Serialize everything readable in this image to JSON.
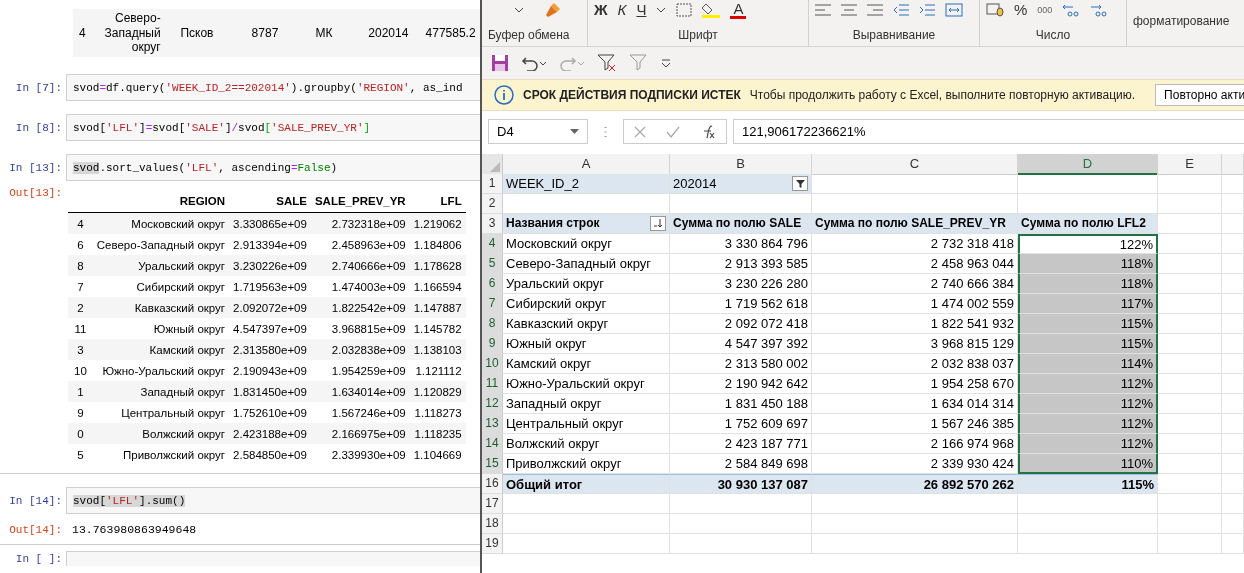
{
  "notebook": {
    "partial_row": [
      "4",
      "Северо-Западный округ",
      "Псков",
      "8787",
      "МК",
      "202014",
      "477585.2"
    ],
    "cells": [
      {
        "kind": "code",
        "prompt": "In [7]:",
        "tokens": [
          {
            "text": "svod",
            "kind": "name",
            "highlight": false
          },
          {
            "text": "=",
            "kind": "op",
            "highlight": false
          },
          {
            "text": "df.query(",
            "kind": "name",
            "highlight": false
          },
          {
            "text": "'WEEK_ID_2==202014'",
            "kind": "string",
            "highlight": false
          },
          {
            "text": ").groupby(",
            "kind": "name",
            "highlight": false
          },
          {
            "text": "'REGION'",
            "kind": "string",
            "highlight": false
          },
          {
            "text": ", as_ind",
            "kind": "name",
            "highlight": false
          }
        ]
      },
      {
        "kind": "code",
        "prompt": "In [8]:",
        "tokens": [
          {
            "text": "svod[",
            "kind": "name",
            "highlight": false
          },
          {
            "text": "'LFL'",
            "kind": "string",
            "highlight": false
          },
          {
            "text": "]",
            "kind": "name",
            "highlight": false
          },
          {
            "text": "=",
            "kind": "op",
            "highlight": false
          },
          {
            "text": "svod[",
            "kind": "name",
            "highlight": false
          },
          {
            "text": "'SALE'",
            "kind": "string",
            "highlight": false
          },
          {
            "text": "]",
            "kind": "name",
            "highlight": false
          },
          {
            "text": "/",
            "kind": "op",
            "highlight": false
          },
          {
            "text": "svod",
            "kind": "name",
            "highlight": false
          },
          {
            "text": "[",
            "kind": "bracket",
            "highlight": false
          },
          {
            "text": "'SALE_PREV_YR'",
            "kind": "string",
            "highlight": false
          },
          {
            "text": "]",
            "kind": "bracket",
            "highlight": false
          }
        ]
      },
      {
        "kind": "code",
        "prompt": "In [13]:",
        "tokens": [
          {
            "text": "svod",
            "kind": "name",
            "highlight": true
          },
          {
            "text": ".sort_values(",
            "kind": "name",
            "highlight": false
          },
          {
            "text": "'LFL'",
            "kind": "string",
            "highlight": false
          },
          {
            "text": ", ascending",
            "kind": "name",
            "highlight": false
          },
          {
            "text": "=",
            "kind": "op",
            "highlight": false
          },
          {
            "text": "False",
            "kind": "keyword",
            "highlight": false
          },
          {
            "text": ")",
            "kind": "name",
            "highlight": false
          }
        ]
      },
      {
        "kind": "table",
        "prompt": "Out[13]:",
        "columns": [
          "",
          "REGION",
          "SALE",
          "SALE_PREV_YR",
          "LFL"
        ],
        "rows": [
          [
            "4",
            "Московский округ",
            "3.330865e+09",
            "2.732318e+09",
            "1.219062"
          ],
          [
            "6",
            "Северо-Западный округ",
            "2.913394e+09",
            "2.458963e+09",
            "1.184806"
          ],
          [
            "8",
            "Уральский округ",
            "3.230226e+09",
            "2.740666e+09",
            "1.178628"
          ],
          [
            "7",
            "Сибирский округ",
            "1.719563e+09",
            "1.474003e+09",
            "1.166594"
          ],
          [
            "2",
            "Кавказский округ",
            "2.092072e+09",
            "1.822542e+09",
            "1.147887"
          ],
          [
            "11",
            "Южный округ",
            "4.547397e+09",
            "3.968815e+09",
            "1.145782"
          ],
          [
            "3",
            "Камский округ",
            "2.313580e+09",
            "2.032838e+09",
            "1.138103"
          ],
          [
            "10",
            "Южно-Уральский округ",
            "2.190943e+09",
            "1.954259e+09",
            "1.121112"
          ],
          [
            "1",
            "Западный округ",
            "1.831450e+09",
            "1.634014e+09",
            "1.120829"
          ],
          [
            "9",
            "Центральный округ",
            "1.752610e+09",
            "1.567246e+09",
            "1.118273"
          ],
          [
            "0",
            "Волжский округ",
            "2.423188e+09",
            "2.166975e+09",
            "1.118235"
          ],
          [
            "5",
            "Приволжский округ",
            "2.584850e+09",
            "2.339930e+09",
            "1.104669"
          ]
        ]
      },
      {
        "kind": "code",
        "prompt": "In [14]:",
        "tokens": [
          {
            "text": "svod[",
            "kind": "name",
            "highlight": true
          },
          {
            "text": "'LFL'",
            "kind": "string",
            "highlight": true
          },
          {
            "text": "].sum()",
            "kind": "name",
            "highlight": true
          }
        ]
      },
      {
        "kind": "text",
        "prompt": "Out[14]:",
        "text": "13.763980863949648"
      },
      {
        "kind": "code",
        "prompt": "In [ ]:"
      }
    ]
  },
  "excel": {
    "ribbon": {
      "font_buttons": [
        "Ж",
        "К",
        "Ч"
      ],
      "font_color": "А",
      "number_buttons": [
        "%",
        "000"
      ],
      "groups": [
        "Буфер обмена",
        "Шрифт",
        "Выравнивание",
        "Число"
      ],
      "partial_label": "форматирование"
    },
    "message_bar": {
      "title": "СРОК ДЕЙСТВИЯ ПОДПИСКИ ИСТЕК",
      "text": "Чтобы продолжить работу с Excel, выполните повторную активацию.",
      "button": "Повторно акти"
    },
    "formula_bar": {
      "name_box": "D4",
      "formula": "121,906172236621%"
    },
    "sheet": {
      "columns": [
        {
          "label": "A",
          "selected": false
        },
        {
          "label": "B",
          "selected": false
        },
        {
          "label": "C",
          "selected": false
        },
        {
          "label": "D",
          "selected": true
        },
        {
          "label": "E",
          "selected": false
        }
      ],
      "rows": [
        {
          "number": "1",
          "kind": "filter",
          "cells": [
            "WEEK_ID_2",
            "202014"
          ]
        },
        {
          "number": "2",
          "kind": "blank"
        },
        {
          "number": "3",
          "kind": "header",
          "cells": [
            "Названия строк",
            "Сумма по полю SALE",
            "Сумма по полю SALE_PREV_YR",
            "Сумма по полю LFL2"
          ]
        },
        {
          "number": "4",
          "kind": "data",
          "selected": true,
          "active": true,
          "cells": [
            "Московский округ",
            "3 330 864 796",
            "2 732 318 418",
            "122%"
          ]
        },
        {
          "number": "5",
          "kind": "data",
          "selected": true,
          "active": false,
          "cells": [
            "Северо-Западный округ",
            "2 913 393 585",
            "2 458 963 044",
            "118%"
          ]
        },
        {
          "number": "6",
          "kind": "data",
          "selected": true,
          "active": false,
          "cells": [
            "Уральский округ",
            "3 230 226 280",
            "2 740 666 384",
            "118%"
          ]
        },
        {
          "number": "7",
          "kind": "data",
          "selected": true,
          "active": false,
          "cells": [
            "Сибирский округ",
            "1 719 562 618",
            "1 474 002 559",
            "117%"
          ]
        },
        {
          "number": "8",
          "kind": "data",
          "selected": true,
          "active": false,
          "cells": [
            "Кавказский округ",
            "2 092 072 418",
            "1 822 541 932",
            "115%"
          ]
        },
        {
          "number": "9",
          "kind": "data",
          "selected": true,
          "active": false,
          "cells": [
            "Южный округ",
            "4 547 397 392",
            "3 968 815 129",
            "115%"
          ]
        },
        {
          "number": "10",
          "kind": "data",
          "selected": true,
          "active": false,
          "cells": [
            "Камский округ",
            "2 313 580 002",
            "2 032 838 037",
            "114%"
          ]
        },
        {
          "number": "11",
          "kind": "data",
          "selected": true,
          "active": false,
          "cells": [
            "Южно-Уральский округ",
            "2 190 942 642",
            "1 954 258 670",
            "112%"
          ]
        },
        {
          "number": "12",
          "kind": "data",
          "selected": true,
          "active": false,
          "cells": [
            "Западный округ",
            "1 831 450 188",
            "1 634 014 314",
            "112%"
          ]
        },
        {
          "number": "13",
          "kind": "data",
          "selected": true,
          "active": false,
          "cells": [
            "Центральный округ",
            "1 752 609 697",
            "1 567 246 385",
            "112%"
          ]
        },
        {
          "number": "14",
          "kind": "data",
          "selected": true,
          "active": false,
          "cells": [
            "Волжский округ",
            "2 423 187 771",
            "2 166 974 968",
            "112%"
          ]
        },
        {
          "number": "15",
          "kind": "data",
          "selected": true,
          "active": false,
          "cells": [
            "Приволжский округ",
            "2 584 849 698",
            "2 339 930 424",
            "110%"
          ]
        },
        {
          "number": "16",
          "kind": "total",
          "cells": [
            "Общий итог",
            "30 930 137 087",
            "26 892 570 262",
            "115%"
          ]
        },
        {
          "number": "17",
          "kind": "blank"
        },
        {
          "number": "18",
          "kind": "blank"
        },
        {
          "number": "19",
          "kind": "blank"
        }
      ]
    }
  }
}
